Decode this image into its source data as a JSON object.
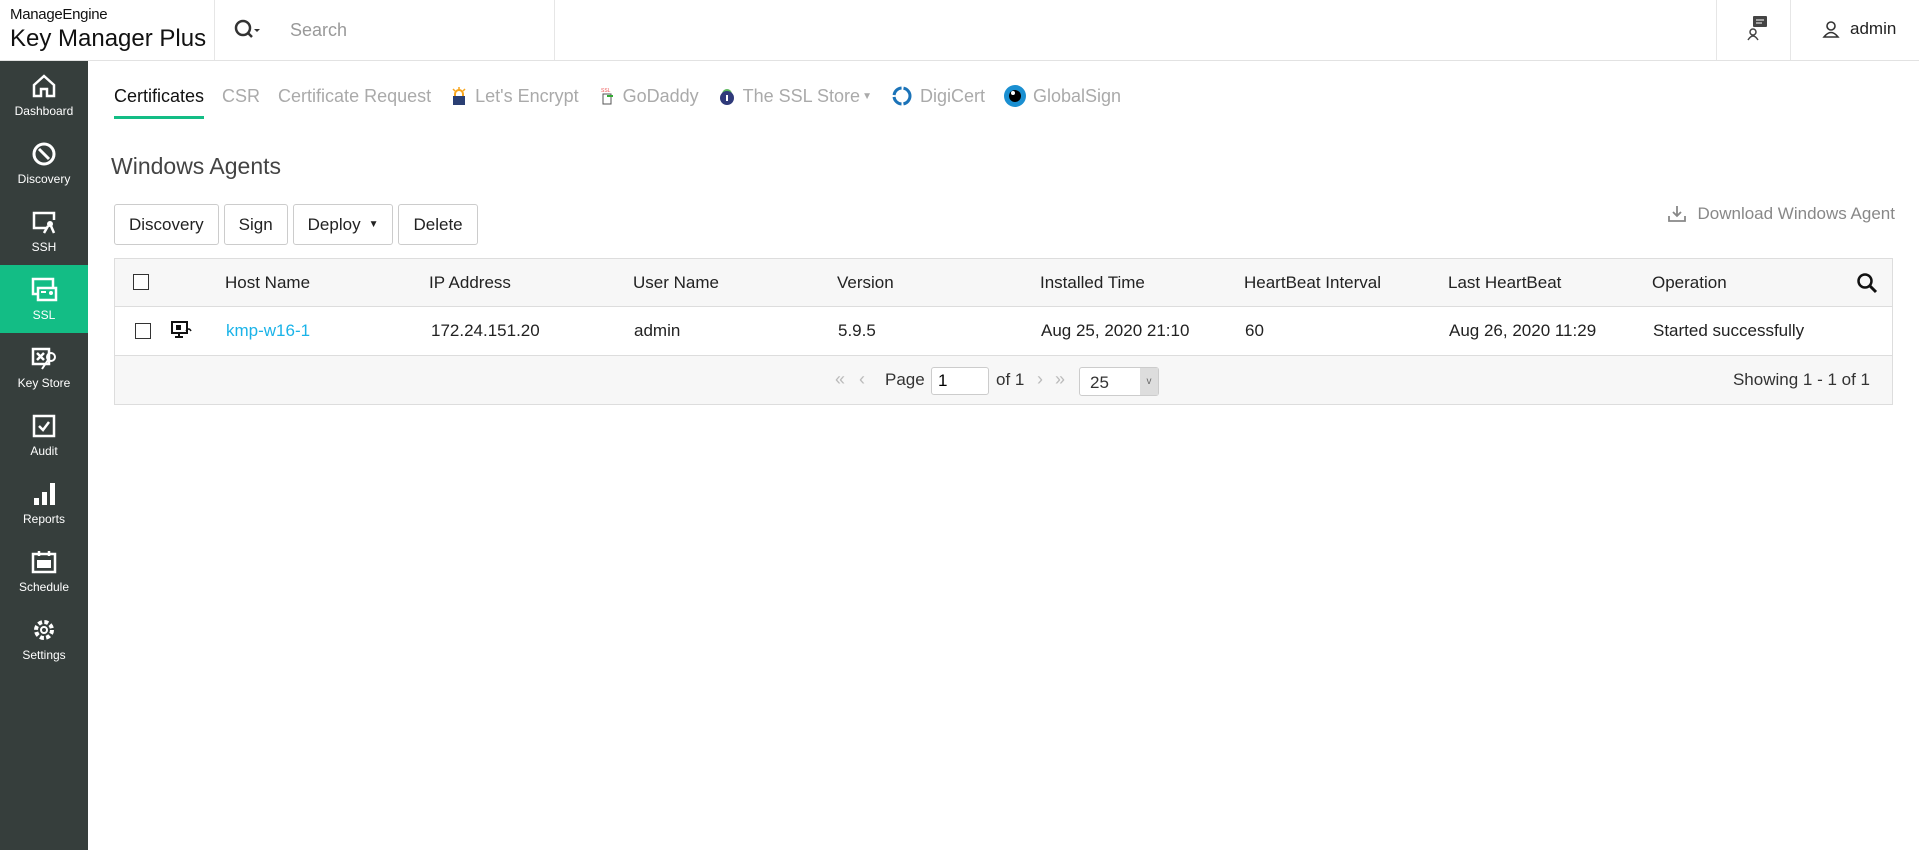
{
  "header": {
    "brand": "ManageEngine",
    "product": "Key Manager Plus",
    "search_placeholder": "Search",
    "user": "admin"
  },
  "sidebar": {
    "items": [
      {
        "label": "Dashboard"
      },
      {
        "label": "Discovery"
      },
      {
        "label": "SSH"
      },
      {
        "label": "SSL"
      },
      {
        "label": "Key Store"
      },
      {
        "label": "Audit"
      },
      {
        "label": "Reports"
      },
      {
        "label": "Schedule"
      },
      {
        "label": "Settings"
      }
    ]
  },
  "tabs": [
    {
      "label": "Certificates"
    },
    {
      "label": "CSR"
    },
    {
      "label": "Certificate Request"
    },
    {
      "label": "Let's Encrypt"
    },
    {
      "label": "GoDaddy"
    },
    {
      "label": "The SSL Store"
    },
    {
      "label": "DigiCert"
    },
    {
      "label": "GlobalSign"
    }
  ],
  "page_title": "Windows Agents",
  "toolbar": {
    "discovery": "Discovery",
    "sign": "Sign",
    "deploy": "Deploy",
    "delete": "Delete",
    "download": "Download Windows Agent"
  },
  "table": {
    "headers": [
      "Host Name",
      "IP Address",
      "User Name",
      "Version",
      "Installed Time",
      "HeartBeat Interval",
      "Last HeartBeat",
      "Operation"
    ],
    "rows": [
      [
        "kmp-w16-1",
        "172.24.151.20",
        "admin",
        "5.9.5",
        "Aug 25, 2020 21:10",
        "60",
        "Aug 26, 2020 11:29",
        "Started successfully"
      ]
    ]
  },
  "pager": {
    "page_label": "Page",
    "page": "1",
    "of": "of 1",
    "page_size": "25",
    "showing": "Showing 1 - 1 of 1"
  },
  "colors": {
    "accent": "#13bd85",
    "sidebar": "#363e3c",
    "link": "#1ab3e8"
  }
}
